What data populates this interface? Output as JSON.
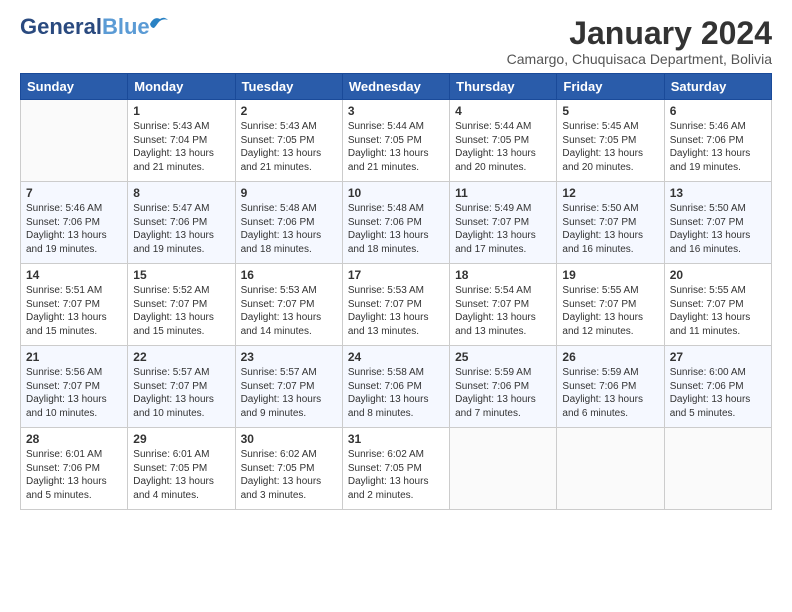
{
  "logo": {
    "line1": "General",
    "line2": "Blue"
  },
  "header": {
    "month_year": "January 2024",
    "location": "Camargo, Chuquisaca Department, Bolivia"
  },
  "days_of_week": [
    "Sunday",
    "Monday",
    "Tuesday",
    "Wednesday",
    "Thursday",
    "Friday",
    "Saturday"
  ],
  "weeks": [
    [
      {
        "day": "",
        "sunrise": "",
        "sunset": "",
        "daylight": ""
      },
      {
        "day": "1",
        "sunrise": "Sunrise: 5:43 AM",
        "sunset": "Sunset: 7:04 PM",
        "daylight": "Daylight: 13 hours and 21 minutes."
      },
      {
        "day": "2",
        "sunrise": "Sunrise: 5:43 AM",
        "sunset": "Sunset: 7:05 PM",
        "daylight": "Daylight: 13 hours and 21 minutes."
      },
      {
        "day": "3",
        "sunrise": "Sunrise: 5:44 AM",
        "sunset": "Sunset: 7:05 PM",
        "daylight": "Daylight: 13 hours and 21 minutes."
      },
      {
        "day": "4",
        "sunrise": "Sunrise: 5:44 AM",
        "sunset": "Sunset: 7:05 PM",
        "daylight": "Daylight: 13 hours and 20 minutes."
      },
      {
        "day": "5",
        "sunrise": "Sunrise: 5:45 AM",
        "sunset": "Sunset: 7:05 PM",
        "daylight": "Daylight: 13 hours and 20 minutes."
      },
      {
        "day": "6",
        "sunrise": "Sunrise: 5:46 AM",
        "sunset": "Sunset: 7:06 PM",
        "daylight": "Daylight: 13 hours and 19 minutes."
      }
    ],
    [
      {
        "day": "7",
        "sunrise": "Sunrise: 5:46 AM",
        "sunset": "Sunset: 7:06 PM",
        "daylight": "Daylight: 13 hours and 19 minutes."
      },
      {
        "day": "8",
        "sunrise": "Sunrise: 5:47 AM",
        "sunset": "Sunset: 7:06 PM",
        "daylight": "Daylight: 13 hours and 19 minutes."
      },
      {
        "day": "9",
        "sunrise": "Sunrise: 5:48 AM",
        "sunset": "Sunset: 7:06 PM",
        "daylight": "Daylight: 13 hours and 18 minutes."
      },
      {
        "day": "10",
        "sunrise": "Sunrise: 5:48 AM",
        "sunset": "Sunset: 7:06 PM",
        "daylight": "Daylight: 13 hours and 18 minutes."
      },
      {
        "day": "11",
        "sunrise": "Sunrise: 5:49 AM",
        "sunset": "Sunset: 7:07 PM",
        "daylight": "Daylight: 13 hours and 17 minutes."
      },
      {
        "day": "12",
        "sunrise": "Sunrise: 5:50 AM",
        "sunset": "Sunset: 7:07 PM",
        "daylight": "Daylight: 13 hours and 16 minutes."
      },
      {
        "day": "13",
        "sunrise": "Sunrise: 5:50 AM",
        "sunset": "Sunset: 7:07 PM",
        "daylight": "Daylight: 13 hours and 16 minutes."
      }
    ],
    [
      {
        "day": "14",
        "sunrise": "Sunrise: 5:51 AM",
        "sunset": "Sunset: 7:07 PM",
        "daylight": "Daylight: 13 hours and 15 minutes."
      },
      {
        "day": "15",
        "sunrise": "Sunrise: 5:52 AM",
        "sunset": "Sunset: 7:07 PM",
        "daylight": "Daylight: 13 hours and 15 minutes."
      },
      {
        "day": "16",
        "sunrise": "Sunrise: 5:53 AM",
        "sunset": "Sunset: 7:07 PM",
        "daylight": "Daylight: 13 hours and 14 minutes."
      },
      {
        "day": "17",
        "sunrise": "Sunrise: 5:53 AM",
        "sunset": "Sunset: 7:07 PM",
        "daylight": "Daylight: 13 hours and 13 minutes."
      },
      {
        "day": "18",
        "sunrise": "Sunrise: 5:54 AM",
        "sunset": "Sunset: 7:07 PM",
        "daylight": "Daylight: 13 hours and 13 minutes."
      },
      {
        "day": "19",
        "sunrise": "Sunrise: 5:55 AM",
        "sunset": "Sunset: 7:07 PM",
        "daylight": "Daylight: 13 hours and 12 minutes."
      },
      {
        "day": "20",
        "sunrise": "Sunrise: 5:55 AM",
        "sunset": "Sunset: 7:07 PM",
        "daylight": "Daylight: 13 hours and 11 minutes."
      }
    ],
    [
      {
        "day": "21",
        "sunrise": "Sunrise: 5:56 AM",
        "sunset": "Sunset: 7:07 PM",
        "daylight": "Daylight: 13 hours and 10 minutes."
      },
      {
        "day": "22",
        "sunrise": "Sunrise: 5:57 AM",
        "sunset": "Sunset: 7:07 PM",
        "daylight": "Daylight: 13 hours and 10 minutes."
      },
      {
        "day": "23",
        "sunrise": "Sunrise: 5:57 AM",
        "sunset": "Sunset: 7:07 PM",
        "daylight": "Daylight: 13 hours and 9 minutes."
      },
      {
        "day": "24",
        "sunrise": "Sunrise: 5:58 AM",
        "sunset": "Sunset: 7:06 PM",
        "daylight": "Daylight: 13 hours and 8 minutes."
      },
      {
        "day": "25",
        "sunrise": "Sunrise: 5:59 AM",
        "sunset": "Sunset: 7:06 PM",
        "daylight": "Daylight: 13 hours and 7 minutes."
      },
      {
        "day": "26",
        "sunrise": "Sunrise: 5:59 AM",
        "sunset": "Sunset: 7:06 PM",
        "daylight": "Daylight: 13 hours and 6 minutes."
      },
      {
        "day": "27",
        "sunrise": "Sunrise: 6:00 AM",
        "sunset": "Sunset: 7:06 PM",
        "daylight": "Daylight: 13 hours and 5 minutes."
      }
    ],
    [
      {
        "day": "28",
        "sunrise": "Sunrise: 6:01 AM",
        "sunset": "Sunset: 7:06 PM",
        "daylight": "Daylight: 13 hours and 5 minutes."
      },
      {
        "day": "29",
        "sunrise": "Sunrise: 6:01 AM",
        "sunset": "Sunset: 7:05 PM",
        "daylight": "Daylight: 13 hours and 4 minutes."
      },
      {
        "day": "30",
        "sunrise": "Sunrise: 6:02 AM",
        "sunset": "Sunset: 7:05 PM",
        "daylight": "Daylight: 13 hours and 3 minutes."
      },
      {
        "day": "31",
        "sunrise": "Sunrise: 6:02 AM",
        "sunset": "Sunset: 7:05 PM",
        "daylight": "Daylight: 13 hours and 2 minutes."
      },
      {
        "day": "",
        "sunrise": "",
        "sunset": "",
        "daylight": ""
      },
      {
        "day": "",
        "sunrise": "",
        "sunset": "",
        "daylight": ""
      },
      {
        "day": "",
        "sunrise": "",
        "sunset": "",
        "daylight": ""
      }
    ]
  ]
}
